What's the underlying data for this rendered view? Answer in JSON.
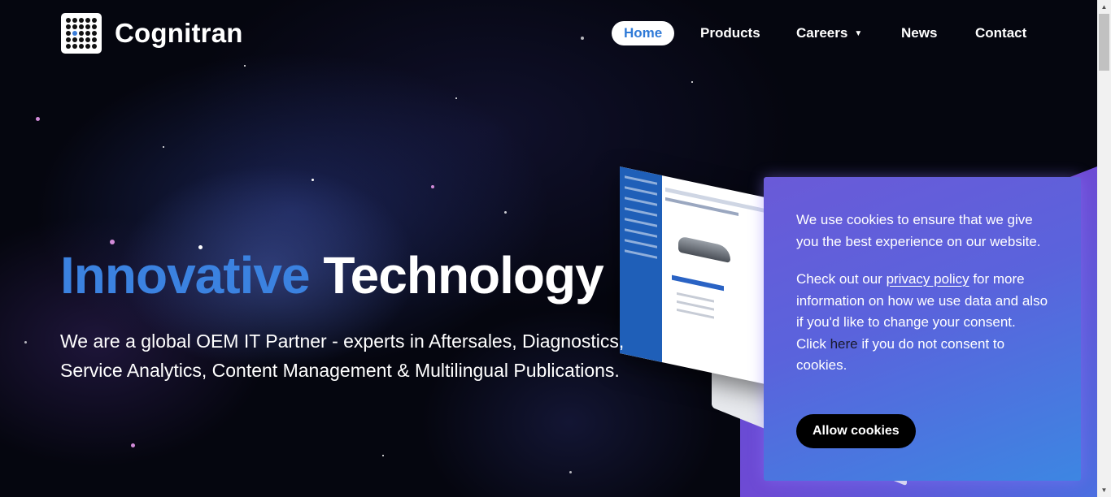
{
  "brand": {
    "name": "Cognitran",
    "logo_icon": "dot-grid-logo-icon"
  },
  "nav": {
    "items": [
      {
        "label": "Home",
        "active": true
      },
      {
        "label": "Products"
      },
      {
        "label": "Careers",
        "icon": "caret-down-icon",
        "caret": "▼"
      },
      {
        "label": "News"
      },
      {
        "label": "Contact"
      }
    ]
  },
  "hero": {
    "title_accent": "Innovative",
    "title_rest": "Technology",
    "subtitle": "We are a global OEM IT Partner - experts in Aftersales, Diagnostics, Service Analytics, Content Management & Multilingual Publications."
  },
  "cookie": {
    "line1": "We use cookies to ensure that we give you the best experience on our website.",
    "line2_pre": "Check out our ",
    "policy_link": "privacy policy",
    "line2_mid": " for more information on how we use data and also if you'd like to change your consent. Click ",
    "here_link": "here",
    "line2_post": " if you do not consent to cookies.",
    "button": "Allow cookies"
  },
  "scrollbar": {
    "up": "▲",
    "down": "▼"
  },
  "colors": {
    "accent_blue": "#3b82e0",
    "background": "#05060f",
    "cookie_gradient_start": "#6a5ad8",
    "cookie_gradient_end": "#3d86e2",
    "button_black": "#000000"
  }
}
